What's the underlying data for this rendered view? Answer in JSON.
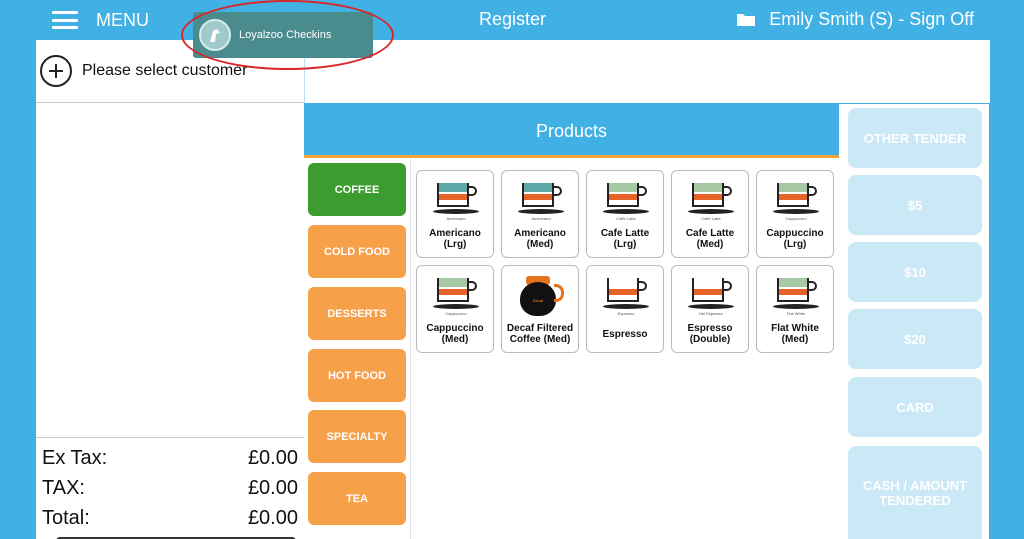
{
  "header": {
    "menu_label": "MENU",
    "loyalty_label": "Loyalzoo Checkins",
    "title": "Register",
    "user_label": "Emily Smith (S) - Sign Off"
  },
  "customer": {
    "label": "Please select customer"
  },
  "totals": [
    {
      "label": "Ex Tax:",
      "value": "£0.00"
    },
    {
      "label": "TAX:",
      "value": "£0.00"
    },
    {
      "label": "Total:",
      "value": "£0.00"
    }
  ],
  "products_title": "Products",
  "categories": [
    {
      "label": "COFFEE",
      "active": true
    },
    {
      "label": "COLD FOOD",
      "active": false
    },
    {
      "label": "DESSERTS",
      "active": false
    },
    {
      "label": "HOT FOOD",
      "active": false
    },
    {
      "label": "SPECIALTY",
      "active": false
    },
    {
      "label": "TEA",
      "active": false
    }
  ],
  "products": [
    {
      "name": "Americano\n(Lrg)",
      "cup_label": "Americano",
      "top_color": "#5fa7a7"
    },
    {
      "name": "Americano\n(Med)",
      "cup_label": "Americano",
      "top_color": "#5fa7a7"
    },
    {
      "name": "Cafe Latte\n(Lrg)",
      "cup_label": "Caffe Latte",
      "top_color": "#a6c8a4"
    },
    {
      "name": "Cafe Latte\n(Med)",
      "cup_label": "Caffe Latte",
      "top_color": "#a6c8a4"
    },
    {
      "name": "Cappuccino\n(Lrg)",
      "cup_label": "Cappuccino",
      "top_color": "#a6c8a4"
    },
    {
      "name": "Cappuccino\n(Med)",
      "cup_label": "Cappuccino",
      "top_color": "#a6c8a4"
    },
    {
      "name": "Decaf Filtered\nCoffee (Med)",
      "cup_label": "Decaf",
      "top_color": "#111111"
    },
    {
      "name": "Espresso",
      "cup_label": "Espresso",
      "top_color": "#ffffff"
    },
    {
      "name": "Espresso\n(Double)",
      "cup_label": "Dbl Espresso",
      "top_color": "#ffffff"
    },
    {
      "name": "Flat White\n(Med)",
      "cup_label": "Flat White",
      "top_color": "#a6c8a4"
    }
  ],
  "tender": [
    {
      "label": "OTHER TENDER"
    },
    {
      "label": "$5"
    },
    {
      "label": "$10"
    },
    {
      "label": "$20"
    },
    {
      "label": "CARD"
    },
    {
      "label": "CASH / AMOUNT TENDERED"
    }
  ],
  "colors": {
    "brand_blue": "#41b0e4",
    "category_active": "#3d9c2f",
    "category_inactive": "#f7a04a",
    "tender_disabled": "#cbe8f6",
    "annotation_red": "#d9262a"
  }
}
